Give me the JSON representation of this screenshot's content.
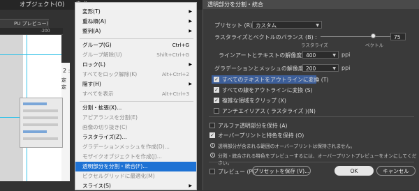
{
  "app": {
    "menubar_items": [
      "オブジェクト(O)",
      "書式"
    ],
    "doc_tab": "PU プレビュー)",
    "ruler_tick": "-200",
    "fragments": [
      "2 :",
      "定",
      "定"
    ]
  },
  "context_menu": {
    "items": [
      {
        "label": "変形(T)",
        "shortcut": "",
        "submenu": true,
        "disabled": false
      },
      {
        "label": "重ね順(A)",
        "shortcut": "",
        "submenu": true,
        "disabled": false
      },
      {
        "label": "整列(A)",
        "shortcut": "",
        "submenu": true,
        "disabled": false
      },
      {
        "label": "グループ(G)",
        "shortcut": "Ctrl+G",
        "submenu": false,
        "disabled": false
      },
      {
        "label": "グループ解除(U)",
        "shortcut": "Shift+Ctrl+G",
        "submenu": false,
        "disabled": true
      },
      {
        "label": "ロック(L)",
        "shortcut": "",
        "submenu": true,
        "disabled": false
      },
      {
        "label": "すべてをロック解除(K)",
        "shortcut": "Alt+Ctrl+2",
        "submenu": false,
        "disabled": true
      },
      {
        "label": "隠す(H)",
        "shortcut": "",
        "submenu": true,
        "disabled": false
      },
      {
        "label": "すべてを表示",
        "shortcut": "Alt+Ctrl+3",
        "submenu": false,
        "disabled": true
      },
      {
        "label": "分割・拡張(X)...",
        "shortcut": "",
        "submenu": false,
        "disabled": false
      },
      {
        "label": "アピアランスを分割(E)",
        "shortcut": "",
        "submenu": false,
        "disabled": true
      },
      {
        "label": "画像の切り抜き(C)",
        "shortcut": "",
        "submenu": false,
        "disabled": true
      },
      {
        "label": "ラスタライズ(Z)...",
        "shortcut": "",
        "submenu": false,
        "disabled": false
      },
      {
        "label": "グラデーションメッシュを作成(D)...",
        "shortcut": "",
        "submenu": false,
        "disabled": true
      },
      {
        "label": "モザイクオブジェクトを作成(J)...",
        "shortcut": "",
        "submenu": false,
        "disabled": true
      },
      {
        "label": "透明部分を分割・統合(F)...",
        "shortcut": "",
        "submenu": false,
        "disabled": false,
        "highlighted": true
      },
      {
        "label": "ピクセルグリッドに最適化(M)",
        "shortcut": "",
        "submenu": false,
        "disabled": true
      },
      {
        "label": "スライス(S)",
        "shortcut": "",
        "submenu": true,
        "disabled": false
      }
    ]
  },
  "dialog": {
    "title": "透明部分を分割・統合",
    "preset_label": "プリセット (R) :",
    "preset_value": "カスタム",
    "balance_label": "ラスタライズとベクトルのバランス (B) :",
    "balance_left": "ラスタライズ",
    "balance_right": "ベクトル",
    "balance_value": "75",
    "balance_fraction": 0.75,
    "lineart_label": "ラインアートとテキストの解像度 (L) :",
    "lineart_value": "400",
    "gradient_label": "グラデーションとメッシュの解像度 (G) :",
    "gradient_value": "200",
    "unit_ppi": "ppi",
    "options": [
      {
        "label": "すべてのテキストをアウトラインに変換 (T)",
        "checked": true,
        "highlighted": true
      },
      {
        "label": "すべての線をアウトラインに変換 (S)",
        "checked": true,
        "highlighted": false
      },
      {
        "label": "複雑な領域をクリップ (X)",
        "checked": true,
        "highlighted": false
      },
      {
        "label": "アンチエイリアス ( ラスタライズ )(N)",
        "checked": false,
        "highlighted": false
      }
    ],
    "alpha_label": "アルファ透明部分を保持 (A)",
    "alpha_checked": false,
    "overprint_label": "オーバープリントと特色を保持 (O)",
    "overprint_checked": true,
    "info1": "透明部分が含まれる範囲のオーバープリントは保持されません。",
    "info2": "分割・統合される特色をプレビューするには、オーバープリントプレビューをオンにしてください。",
    "preview_label": "プレビュー (P)",
    "preview_checked": false,
    "save_preset_label": "プリセットを保存 (V)...",
    "ok_label": "OK",
    "cancel_label": "キャンセル"
  }
}
